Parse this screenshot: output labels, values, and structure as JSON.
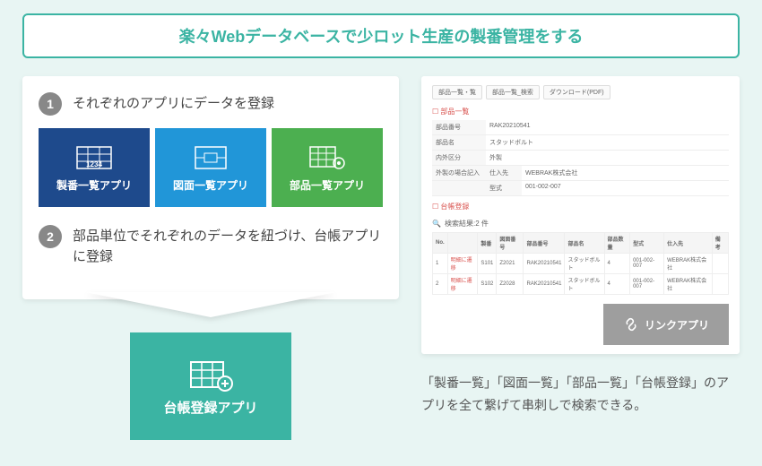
{
  "title": "楽々Webデータベースで少ロット生産の製番管理をする",
  "left": {
    "step1": {
      "num": "1",
      "text": "それぞれのアプリにデータを登録"
    },
    "tiles": [
      {
        "label": "製番一覧アプリ"
      },
      {
        "label": "図面一覧アプリ"
      },
      {
        "label": "部品一覧アプリ"
      }
    ],
    "step2": {
      "num": "2",
      "text": "部品単位でそれぞれのデータを紐づけ、台帳アプリに登録"
    },
    "ledger": {
      "label": "台帳登録アプリ"
    }
  },
  "right": {
    "tabs": [
      "部品一覧・覧",
      "部品一覧_検索",
      "ダウンロード(PDF)"
    ],
    "section1": "部品一覧",
    "detail_rows": [
      {
        "k": "部品番号",
        "v": "RAK20210541"
      },
      {
        "k": "部品名",
        "v": "スタッドボルト"
      },
      {
        "k": "内外区分",
        "v": "外製"
      },
      {
        "k": "外製の場合記入",
        "v": ""
      }
    ],
    "detail_rows2": [
      {
        "k": "仕入先",
        "v": "WEBRAK株式会社"
      },
      {
        "k": "型式",
        "v": "001-002-007"
      }
    ],
    "section2": "台帳登録",
    "result_label": "検索結果:2 件",
    "table": {
      "headers": [
        "No.",
        "",
        "製番",
        "図面番号",
        "部品番号",
        "部品名",
        "部品数量",
        "型式",
        "仕入先",
        "備考"
      ],
      "rows": [
        [
          "1",
          "明細に遷移",
          "S101",
          "Z2021",
          "RAK20210541",
          "スタッドボルト",
          "4",
          "001-002-007",
          "WEBRAK株式会社",
          ""
        ],
        [
          "2",
          "明細に遷移",
          "S102",
          "Z2028",
          "RAK20210541",
          "スタッドボルト",
          "4",
          "001-002-007",
          "WEBRAK株式会社",
          ""
        ]
      ]
    },
    "link_label": "リンクアプリ",
    "description": "「製番一覧」「図面一覧」「部品一覧」「台帳登録」のアプリを全て繋げて串刺しで検索できる。"
  }
}
